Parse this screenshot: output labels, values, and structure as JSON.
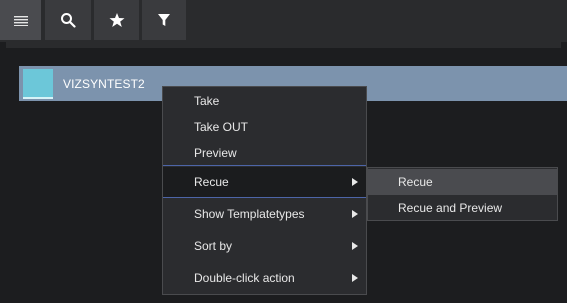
{
  "toolbar": {
    "buttons": [
      {
        "icon": "menu-icon"
      },
      {
        "icon": "search-icon"
      },
      {
        "icon": "star-icon"
      },
      {
        "icon": "filter-icon"
      }
    ]
  },
  "list": {
    "items": [
      {
        "label": "VIZSYNTEST2",
        "thumb_color": "#6cc7d9"
      }
    ]
  },
  "context_menu": {
    "items": [
      {
        "label": "Take"
      },
      {
        "label": "Take OUT"
      },
      {
        "label": "Preview"
      },
      {
        "label": "Recue"
      },
      {
        "label": "Show Templatetypes"
      },
      {
        "label": "Sort by"
      },
      {
        "label": "Double-click action"
      }
    ]
  },
  "submenu": {
    "items": [
      {
        "label": "Recue"
      },
      {
        "label": "Recue and Preview"
      }
    ]
  },
  "colors": {
    "background": "#1c1d1f",
    "selected_row": "#7c93ad",
    "separator": "#4d65a8"
  }
}
